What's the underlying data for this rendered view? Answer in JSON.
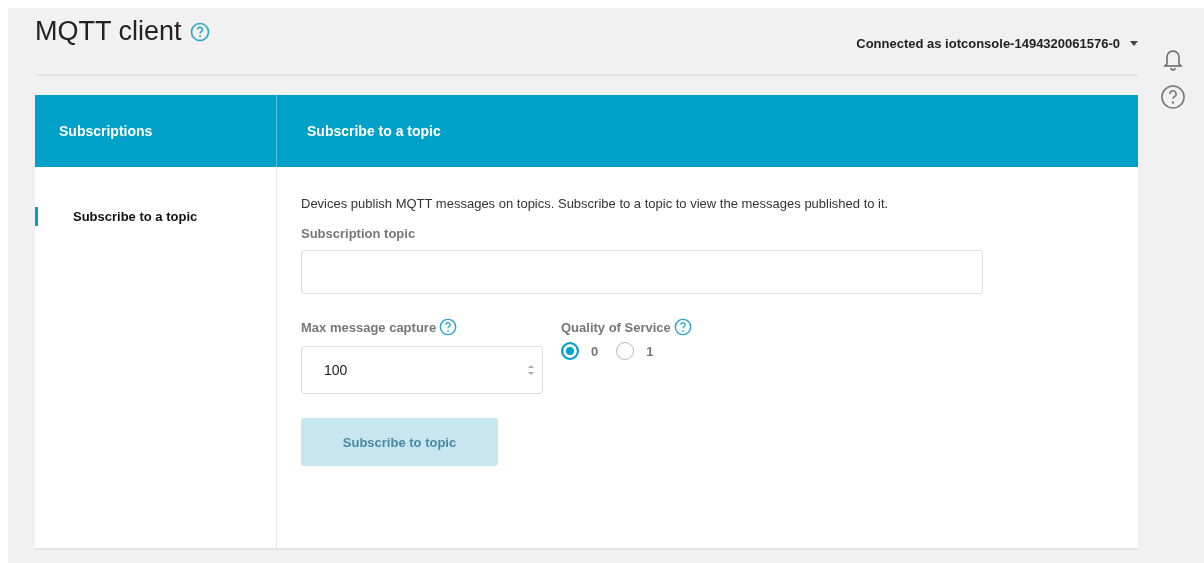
{
  "page": {
    "title": "MQTT client",
    "connection": "Connected as iotconsole-1494320061576-0"
  },
  "panel": {
    "sidebar_header": "Subscriptions",
    "content_header": "Subscribe to a topic",
    "sidebar_items": [
      {
        "label": "Subscribe to a topic",
        "selected": true
      }
    ],
    "description": "Devices publish MQTT messages on topics. Subscribe to a topic to view the messages published to it.",
    "topic_field": {
      "label": "Subscription topic"
    },
    "capture_field": {
      "label": "Max message capture",
      "value": "100"
    },
    "qos": {
      "label": "Quality of Service",
      "options": [
        {
          "label": "0",
          "selected": true
        },
        {
          "label": "1",
          "selected": false
        }
      ]
    },
    "submit": {
      "label": "Subscribe to topic",
      "disabled": true
    }
  }
}
